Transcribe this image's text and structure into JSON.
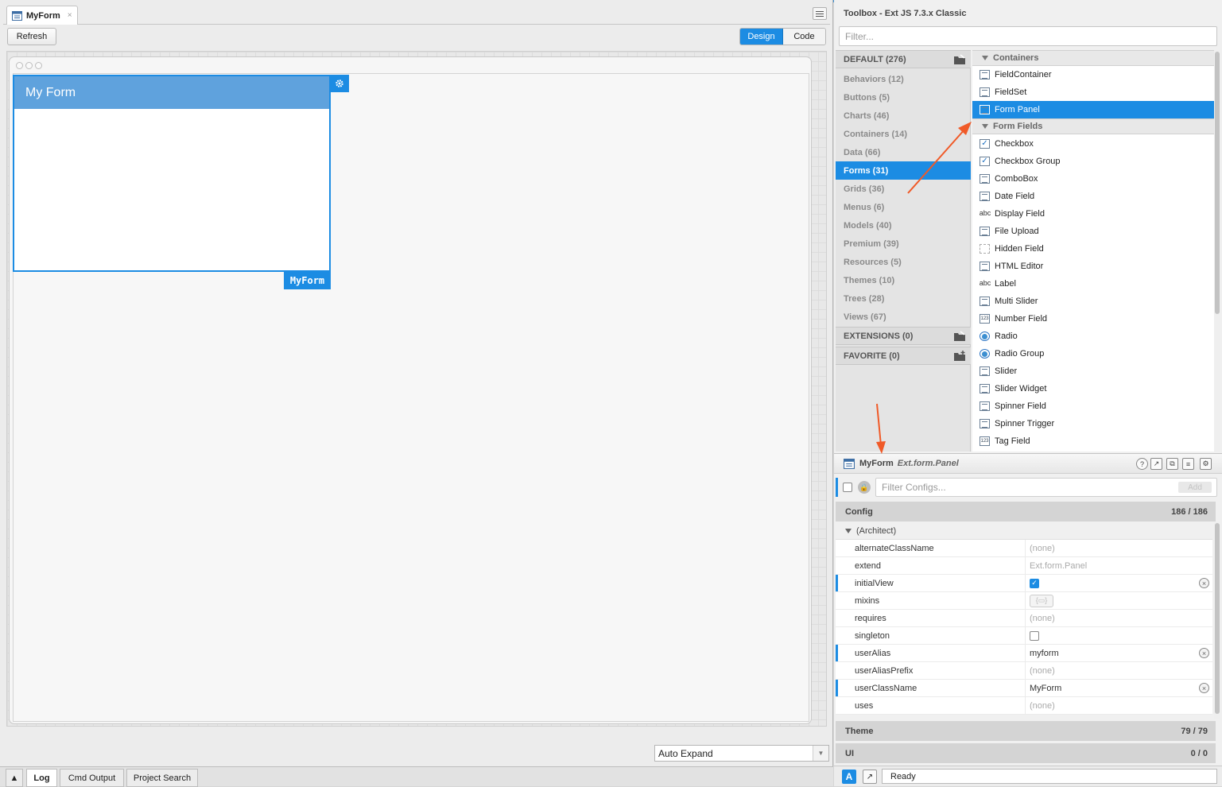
{
  "editor": {
    "tab_label": "MyForm",
    "tab_close": "×",
    "refresh_label": "Refresh",
    "design_label": "Design",
    "code_label": "Code",
    "form_title": "My Form",
    "form_tag": "MyForm",
    "auto_expand": "Auto Expand",
    "bottom_tabs": [
      "Log",
      "Cmd Output",
      "Project Search"
    ]
  },
  "toolbox": {
    "title": "Toolbox - Ext JS 7.3.x Classic",
    "filter_placeholder": "Filter...",
    "categories": {
      "default": "DEFAULT (276)",
      "items": [
        "Behaviors (12)",
        "Buttons (5)",
        "Charts (46)",
        "Containers (14)",
        "Data (66)",
        "Forms (31)",
        "Grids (36)",
        "Menus (6)",
        "Models (40)",
        "Premium (39)",
        "Resources (5)",
        "Themes (10)",
        "Trees (28)",
        "Views (67)"
      ],
      "extensions": "EXTENSIONS (0)",
      "favorite": "FAVORITE (0)",
      "selected_index": 5
    },
    "groups": {
      "containers": "Containers",
      "form_fields": "Form Fields"
    },
    "container_items": [
      "FieldContainer",
      "FieldSet",
      "Form Panel"
    ],
    "field_items": [
      "Checkbox",
      "Checkbox Group",
      "ComboBox",
      "Date Field",
      "Display Field",
      "File Upload",
      "Hidden Field",
      "HTML Editor",
      "Label",
      "Multi Slider",
      "Number Field",
      "Radio",
      "Radio Group",
      "Slider",
      "Slider Widget",
      "Spinner Field",
      "Spinner Trigger",
      "Tag Field"
    ],
    "icon_text": {
      "abc": "abc",
      "num": "123"
    }
  },
  "inspector": {
    "class_name": "MyForm",
    "class_type": "Ext.form.Panel",
    "filter_placeholder": "Filter Configs...",
    "add_label": "Add",
    "config_label": "Config",
    "config_count": "186 / 186",
    "architect_group": "(Architect)",
    "rows": [
      {
        "key": "alternateClassName",
        "value": "(none)"
      },
      {
        "key": "extend",
        "value": "Ext.form.Panel"
      },
      {
        "key": "initialView",
        "value": ""
      },
      {
        "key": "mixins",
        "value": ""
      },
      {
        "key": "requires",
        "value": "(none)"
      },
      {
        "key": "singleton",
        "value": ""
      },
      {
        "key": "userAlias",
        "value": "myform"
      },
      {
        "key": "userAliasPrefix",
        "value": "(none)"
      },
      {
        "key": "userClassName",
        "value": "MyForm"
      },
      {
        "key": "uses",
        "value": "(none)"
      }
    ],
    "theme_label": "Theme",
    "theme_count": "79 / 79",
    "ui_label": "UI",
    "ui_count": "0 / 0",
    "help_icon": "?",
    "status_a": "A",
    "status_text": "Ready"
  },
  "colors": {
    "accent": "#1c8ce3",
    "form_header": "#5fa2dd",
    "annotation_arrow": "#f05a28"
  }
}
